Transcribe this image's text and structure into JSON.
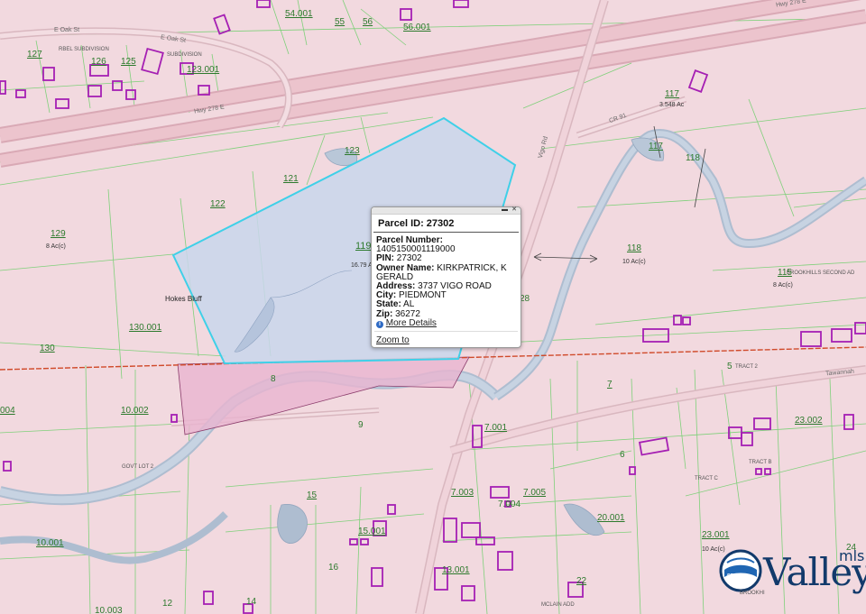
{
  "roads": {
    "hwy_top": "Hwy 278 E",
    "hwy_mid": "Hwy 278 E",
    "oak_st": "E Oak St",
    "e_oak_st": "E Oak St",
    "vigo": "Vigo Rd",
    "tawannah": "Tawannah",
    "cr": "CR 91"
  },
  "places": {
    "hokes_bluff": "Hokes Bluff",
    "brookhills": "BROOKHILLS SECOND AD",
    "subdiv_top": "RBEL SUBDIVISION",
    "subdiv_top2": "SUBDIVISION",
    "tract": "TRACT 2",
    "tract_b": "TRACT B",
    "tract_c": "TRACT C",
    "mclain": "MCLAIN ADD",
    "gov": "GOVT LOT 2",
    "brook_small": "BROOKHI"
  },
  "parcels": {
    "p54001": "54.001",
    "p55": "55",
    "p56": "56",
    "p56001": "56.001",
    "p127": "127",
    "p126": "126",
    "p125": "125",
    "p123001": "123.001",
    "p117": "117",
    "p117b": "117",
    "p117_acres": "3.548 Ac",
    "p118": "118",
    "p118b": "118",
    "p118_acres": "10 Ac(c)",
    "p115": "115",
    "p115_acres": "8 Ac(c)",
    "p123": "123",
    "p121": "121",
    "p122": "122",
    "p129": "129",
    "p129_acres": "8 Ac(c)",
    "p119": "119",
    "p119_acres": "16.79 A",
    "p130001": "130.001",
    "p130": "130",
    "p28": "28",
    "p8": "8",
    "p9": "9",
    "p7": "7",
    "p5": "5",
    "p7001": "7.001",
    "p6": "6",
    "p10002": "10.002",
    "p004": "004",
    "p23002": "23.002",
    "p7003": "7.003",
    "p7004": "7.004",
    "p7005": "7.005",
    "p15": "15",
    "p15001": "15.001",
    "p20001": "20.001",
    "p23001": "23.001",
    "p23001_acres": "10 Ac(c)",
    "p10001": "10.001",
    "p16": "16",
    "p13001": "13.001",
    "p22": "22",
    "p12": "12",
    "p14": "14",
    "p10003": "10.003",
    "p24": "24"
  },
  "popup": {
    "title": "Parcel ID: 27302",
    "parcel_number_label": "Parcel Number:",
    "parcel_number": "1405150001119000",
    "pin_label": "PIN:",
    "pin": "27302",
    "owner_label": "Owner Name:",
    "owner_1": "KIRKPATRICK, K",
    "owner_2": "GERALD",
    "address_label": "Address:",
    "address": "3737 VIGO ROAD",
    "city_label": "City:",
    "city": "PIEDMONT",
    "state_label": "State:",
    "state": "AL",
    "zip_label": "Zip:",
    "zip": "36272",
    "info_icon": "i",
    "more_details": "More Details",
    "zoom_to": "Zoom to",
    "minimize_icon": "▬",
    "close_icon": "✕"
  },
  "logo": {
    "word": "Valley",
    "suffix": "mls.c",
    "tagline": "SECOND"
  },
  "colors": {
    "background": "#f2d9df",
    "parcel_line": "#7fd07a",
    "highway": "#e8b7c2",
    "highlight_fill": "#c9d6ec",
    "highlight_stroke": "#3fd0e8",
    "building": "#a51fb3",
    "creek": "#b8c7d9",
    "boundary": "#d04a2a"
  }
}
